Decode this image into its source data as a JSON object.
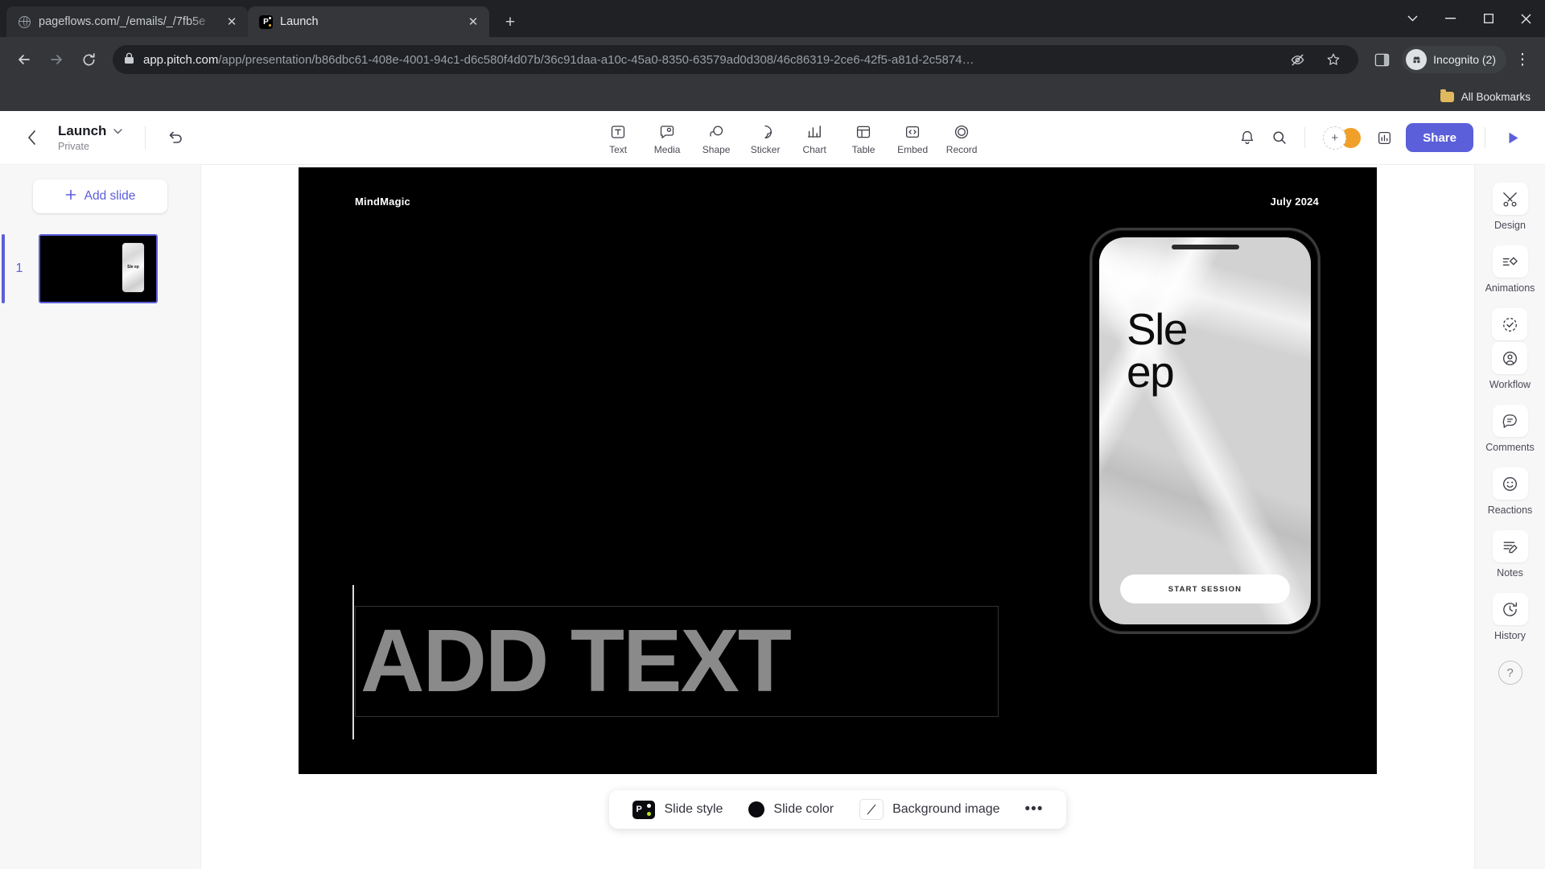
{
  "browser": {
    "tabs": [
      {
        "title": "pageflows.com/_/emails/_/7fb5e",
        "favicon": "globe-icon",
        "active": false
      },
      {
        "title": "Launch",
        "favicon": "pitch-icon",
        "active": true
      }
    ],
    "new_tab_label": "+",
    "url": {
      "host": "app.pitch.com",
      "path": "/app/presentation/b86dbc61-408e-4001-94c1-d6c580f4d07b/36c91daa-a10c-45a0-8350-63579ad0d308/46c86319-2ce6-42f5-a81d-2c5874…"
    },
    "profile_label": "Incognito (2)",
    "bookmarks_label": "All Bookmarks"
  },
  "header": {
    "deck_title": "Launch",
    "deck_visibility": "Private",
    "tools": [
      {
        "label": "Text",
        "icon": "text-icon"
      },
      {
        "label": "Media",
        "icon": "media-icon"
      },
      {
        "label": "Shape",
        "icon": "shape-icon"
      },
      {
        "label": "Sticker",
        "icon": "sticker-icon"
      },
      {
        "label": "Chart",
        "icon": "chart-icon"
      },
      {
        "label": "Table",
        "icon": "table-icon"
      },
      {
        "label": "Embed",
        "icon": "embed-icon"
      },
      {
        "label": "Record",
        "icon": "record-icon"
      }
    ],
    "share_label": "Share",
    "accent_color": "#5b5fd9",
    "avatar_color": "#f0a028"
  },
  "slides_panel": {
    "add_slide_label": "Add slide",
    "slides": [
      {
        "number": "1",
        "thumb_text": "Sle ep"
      }
    ]
  },
  "slide": {
    "brand": "MindMagic",
    "date": "July 2024",
    "background_color": "#000000",
    "text_placeholder": "ADD TEXT",
    "phone": {
      "title_line1": "Sle",
      "title_line2": "ep",
      "cta_label": "START SESSION"
    }
  },
  "slide_bar": {
    "style_label": "Slide style",
    "color_label": "Slide color",
    "color_value": "#0b0b0f",
    "background_image_label": "Background image",
    "more_label": "•••"
  },
  "right_rail": [
    {
      "label": "Design",
      "icons": [
        "design-icon"
      ]
    },
    {
      "label": "Animations",
      "icons": [
        "animations-icon"
      ]
    },
    {
      "label": "Workflow",
      "icons": [
        "workflow-check-icon",
        "workflow-person-icon"
      ]
    },
    {
      "label": "Comments",
      "icons": [
        "comments-icon"
      ]
    },
    {
      "label": "Reactions",
      "icons": [
        "reactions-icon"
      ]
    },
    {
      "label": "Notes",
      "icons": [
        "notes-icon"
      ]
    },
    {
      "label": "History",
      "icons": [
        "history-icon"
      ]
    }
  ],
  "help_label": "?"
}
